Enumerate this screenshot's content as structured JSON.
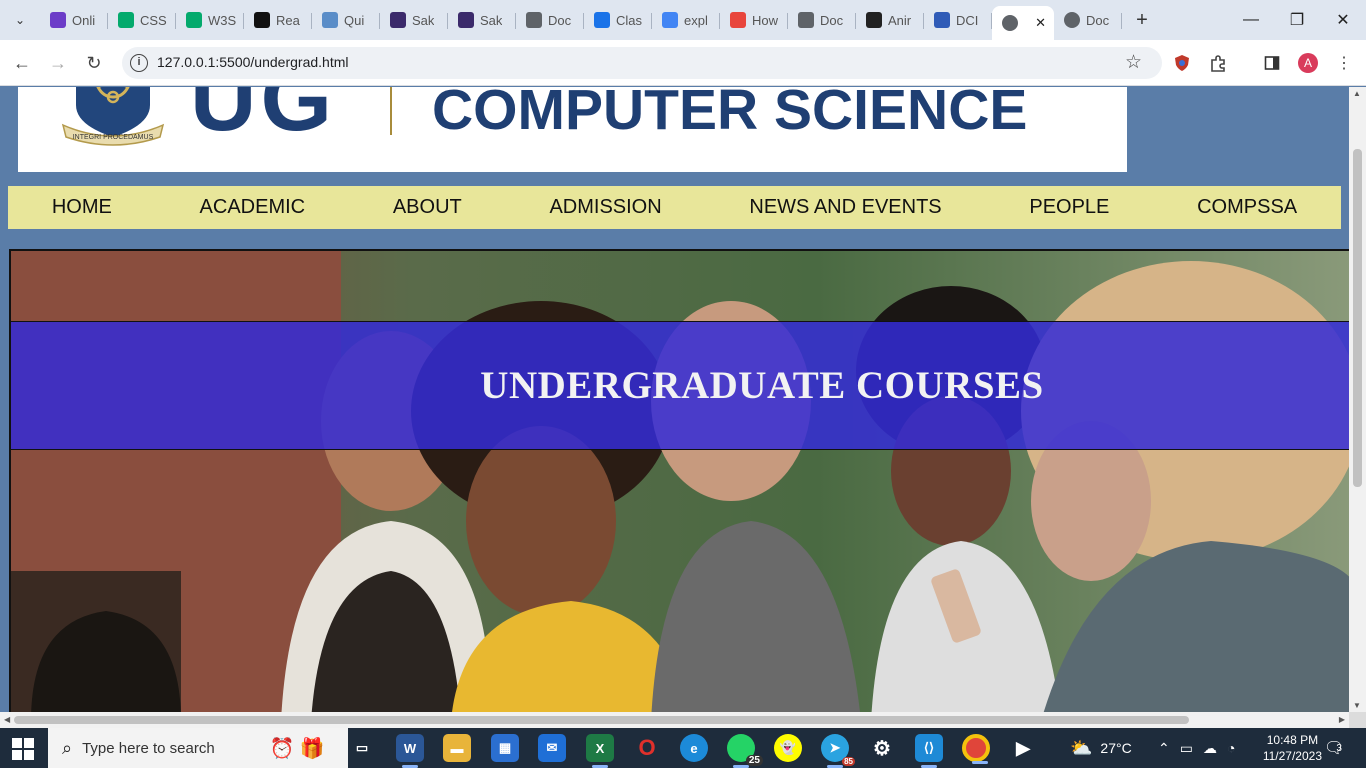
{
  "browser": {
    "tabs": [
      {
        "title": "Onli",
        "icon": "p-icon",
        "color": "#6c3cc8"
      },
      {
        "title": "CSS",
        "icon": "w3schools-icon",
        "color": "#04aa6d"
      },
      {
        "title": "W3S",
        "icon": "w3schools-icon",
        "color": "#04aa6d"
      },
      {
        "title": "Rea",
        "icon": "r-icon",
        "color": "#111111"
      },
      {
        "title": "Qui",
        "icon": "react-icon",
        "color": "#5a8dc8"
      },
      {
        "title": "Sak",
        "icon": "crest-icon",
        "color": "#3b2a6b"
      },
      {
        "title": "Sak",
        "icon": "crest-icon",
        "color": "#3b2a6b"
      },
      {
        "title": "Doc",
        "icon": "globe-icon",
        "color": "#5f6368"
      },
      {
        "title": "Clas",
        "icon": "classroom-icon",
        "color": "#1a73e8"
      },
      {
        "title": "expl",
        "icon": "google-icon",
        "color": "#4285f4"
      },
      {
        "title": "How",
        "icon": "pin-icon",
        "color": "#e8453c"
      },
      {
        "title": "Doc",
        "icon": "globe-icon",
        "color": "#5f6368"
      },
      {
        "title": "Anir",
        "icon": "github-icon",
        "color": "#222222"
      },
      {
        "title": "DCI",
        "icon": "doc-icon",
        "color": "#2f5bb7"
      }
    ],
    "active_tab": {
      "title": "",
      "close": "✕"
    },
    "last_tab": {
      "title": "Doc"
    },
    "new_tab": "+",
    "url": "127.0.0.1:5500/undergrad.html"
  },
  "page": {
    "department": "COMPUTER SCIENCE",
    "ug_logo_text": "UG",
    "crest_motto": "INTEGRI PROCEDAMUS",
    "nav": [
      "HOME",
      "ACADEMIC",
      "ABOUT",
      "ADMISSION",
      "NEWS AND EVENTS",
      "PEOPLE",
      "COMPSSA"
    ],
    "hero_title": "UNDERGRADUATE COURSES"
  },
  "taskbar": {
    "search_placeholder": "Type here to search",
    "whatsapp_badge": "25",
    "telegram_badge": "85",
    "weather": "27°C",
    "time": "10:48 PM",
    "date": "11/27/2023",
    "notifications": "3"
  },
  "colors": {
    "page_bg": "#5a7da8",
    "brand_navy": "#1f3f73",
    "nav_bg": "#e8e69a",
    "hero_band": "#342cd6"
  }
}
